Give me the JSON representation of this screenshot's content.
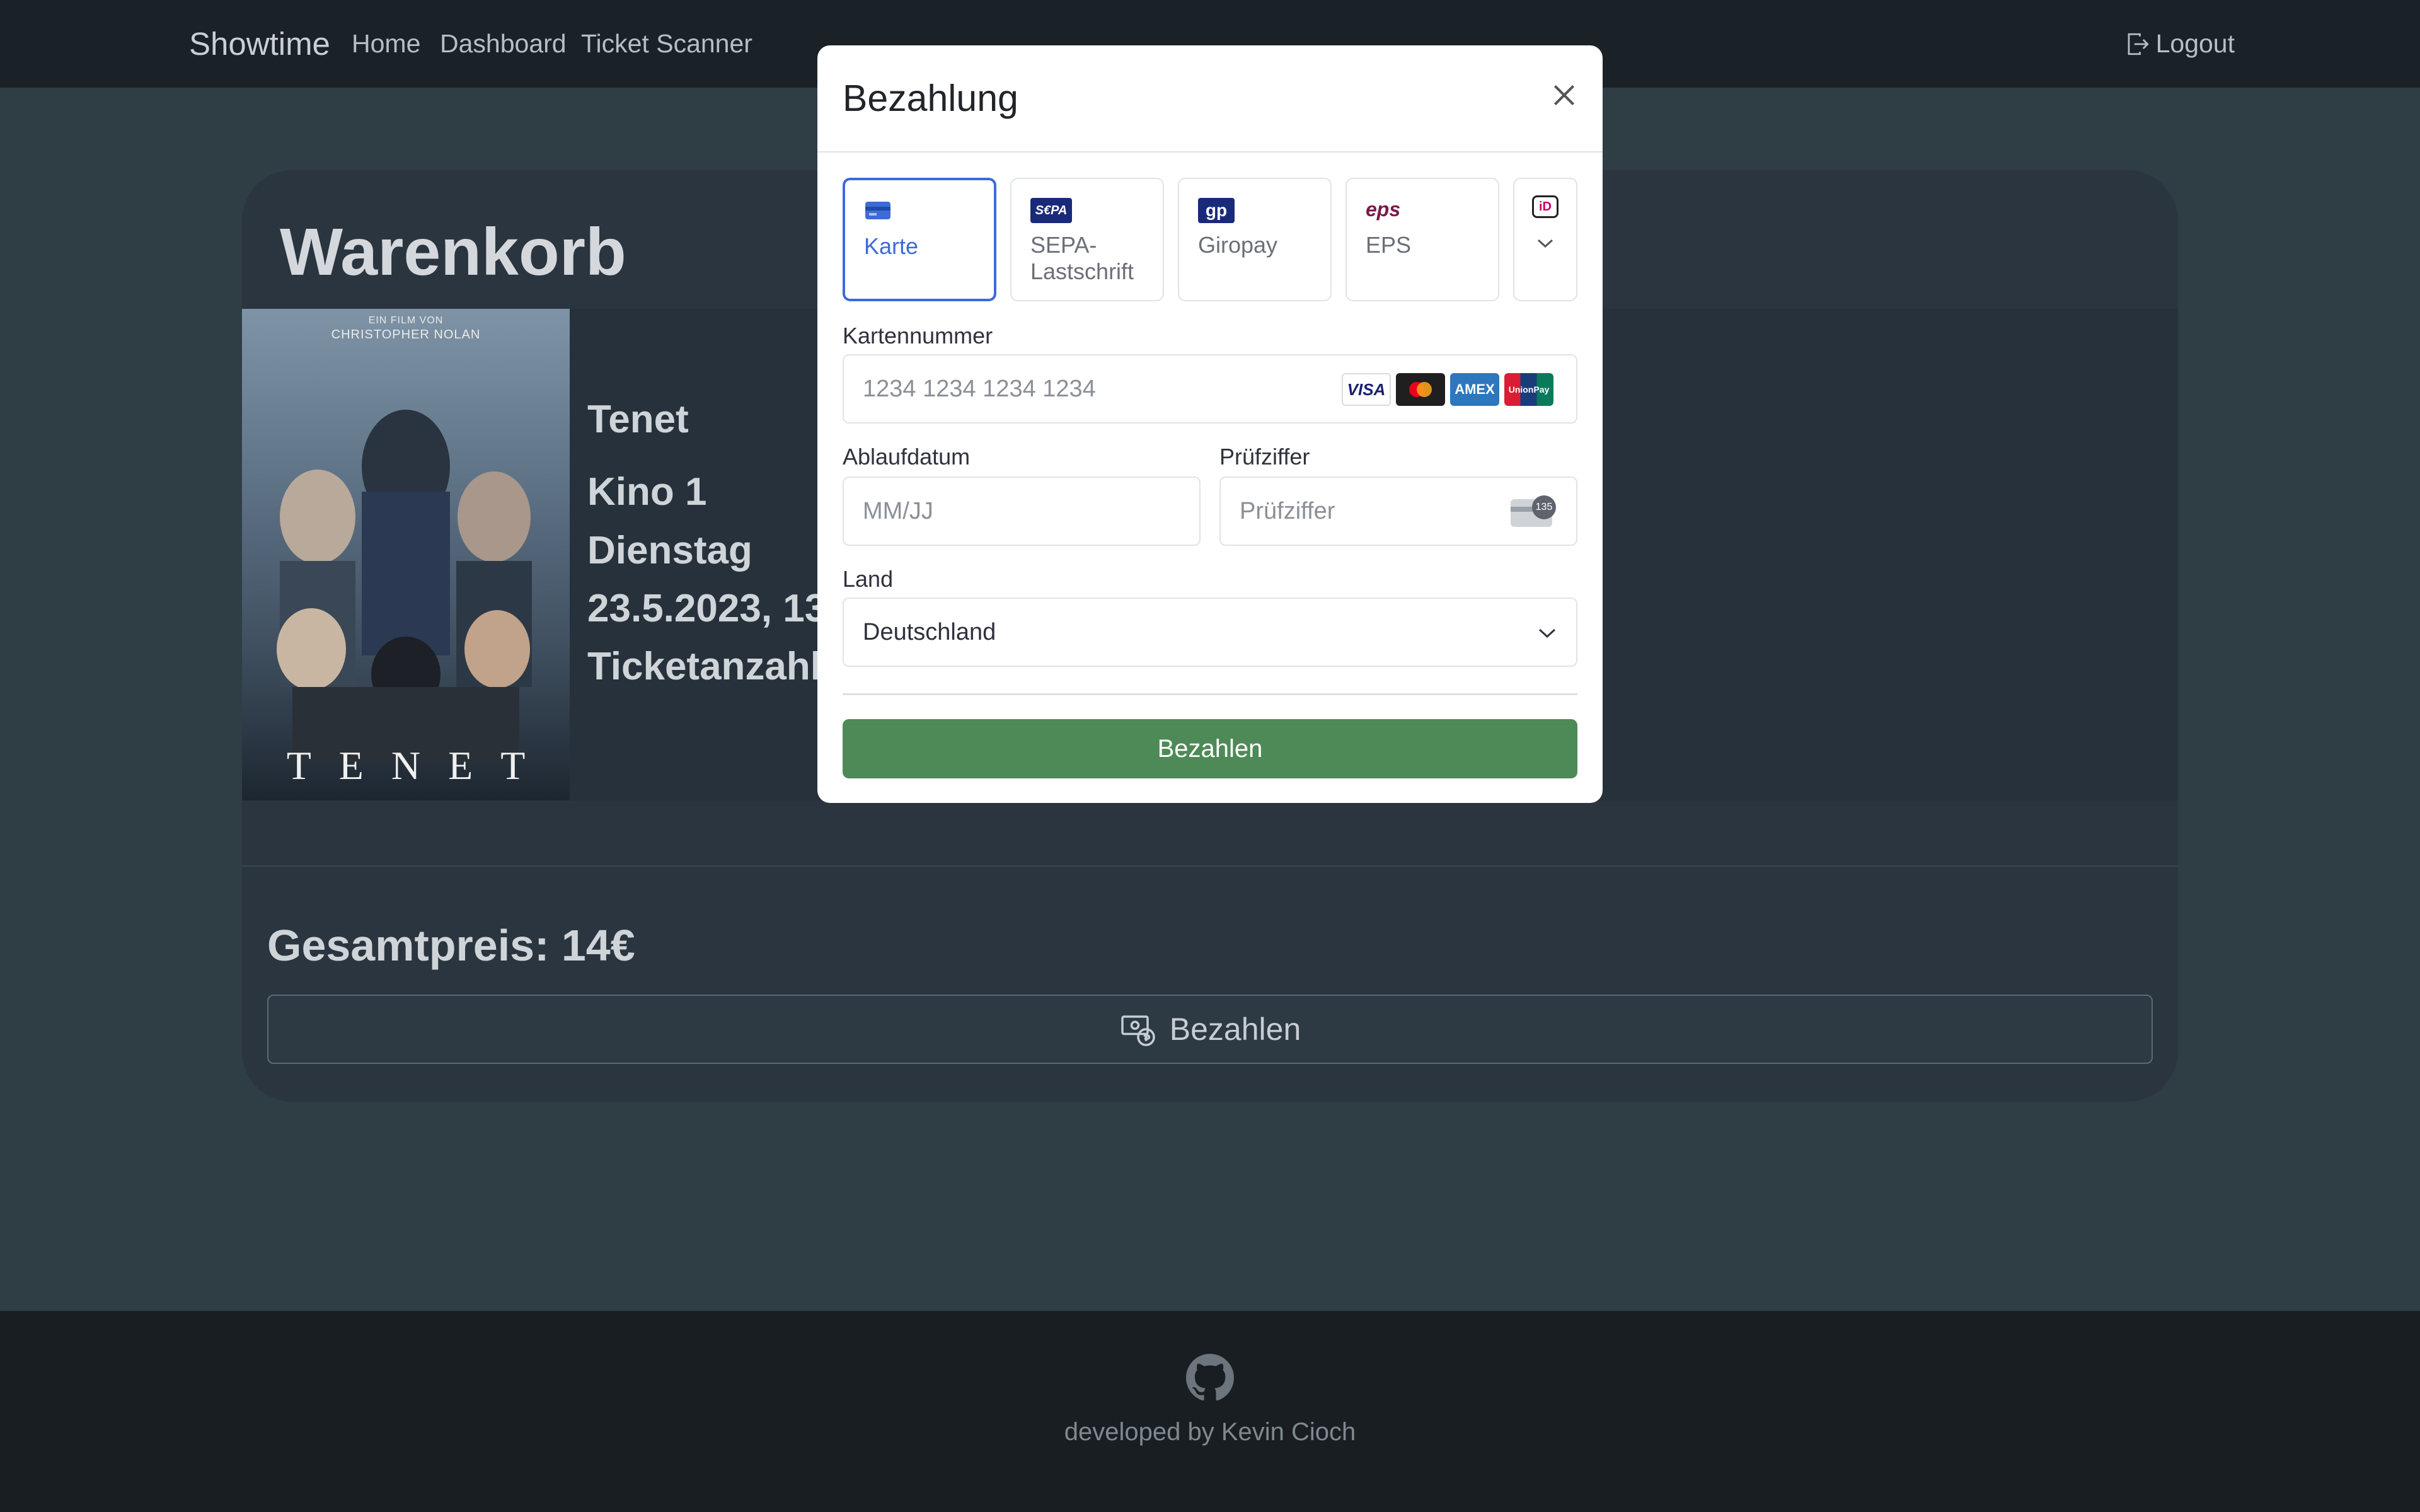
{
  "navbar": {
    "brand": "Showtime",
    "links": [
      "Home",
      "Dashboard",
      "Ticket Scanner"
    ],
    "logout": "Logout"
  },
  "cart": {
    "title": "Warenkorb",
    "item": {
      "poster_top": "EIN FILM VON",
      "poster_director": "CHRISTOPHER NOLAN",
      "poster_title": "TENET",
      "name": "Tenet",
      "cinema": "Kino 1",
      "day": "Dienstag",
      "datetime": "23.5.2023, 13:",
      "tickets": "Ticketanzahl:"
    },
    "total": "Gesamtpreis: 14€",
    "pay_button": "Bezahlen"
  },
  "footer": {
    "developer": "developed by Kevin Cioch"
  },
  "modal": {
    "title": "Bezahlung",
    "methods": [
      {
        "label": "Karte",
        "icon": "card-icon",
        "active": true
      },
      {
        "label": "SEPA-\nLastschrift",
        "icon": "sepa-icon",
        "active": false
      },
      {
        "label": "Giropay",
        "icon": "giropay-icon",
        "active": false
      },
      {
        "label": "EPS",
        "icon": "eps-icon",
        "active": false
      },
      {
        "label": "",
        "icon": "ideal-icon",
        "active": false
      }
    ],
    "sepa_logo": "S€PA",
    "giropay_logo": "gp",
    "eps_logo": "eps",
    "ideal_logo": "iD",
    "card_number_label": "Kartennummer",
    "card_number_placeholder": "1234 1234 1234 1234",
    "card_brands": [
      "VISA",
      "Mastercard",
      "AMEX",
      "UnionPay"
    ],
    "expiry_label": "Ablaufdatum",
    "expiry_placeholder": "MM/JJ",
    "cvc_label": "Prüfziffer",
    "cvc_placeholder": "Prüfziffer",
    "cvc_hint": "135",
    "country_label": "Land",
    "country_value": "Deutschland",
    "submit": "Bezahlen"
  },
  "colors": {
    "accent": "#3d6bd6",
    "submit": "#4e8a57",
    "page_bg": "#2f3d45"
  }
}
